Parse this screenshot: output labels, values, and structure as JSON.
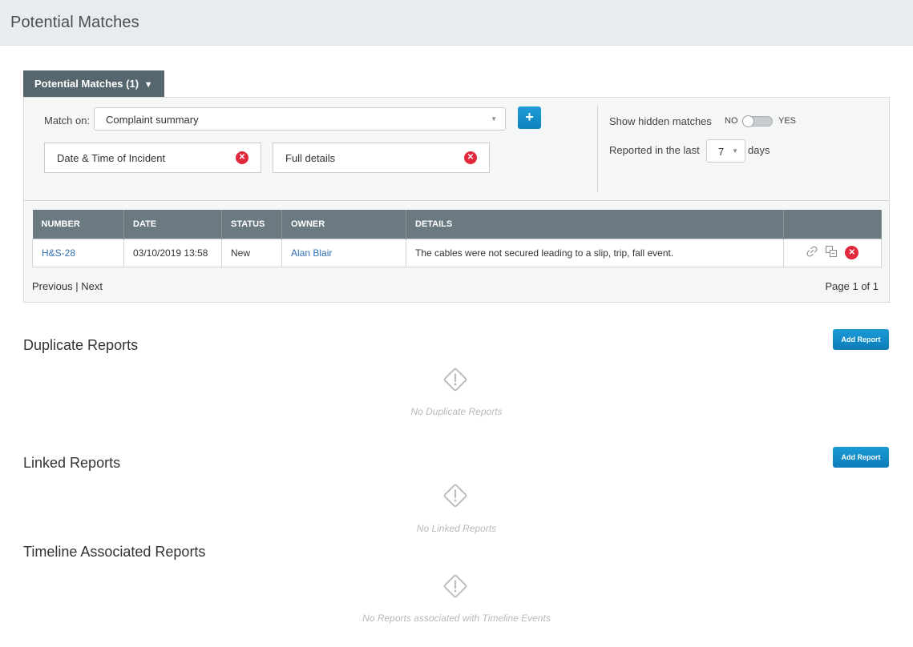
{
  "header": {
    "title": "Potential Matches"
  },
  "potential_matches": {
    "tab_label": "Potential Matches (1)",
    "tab_caret": "▼",
    "match_on_label": "Match on:",
    "match_on_value": "Complaint summary",
    "add_button_symbol": "+",
    "criteria": [
      {
        "label": "Date & Time of Incident"
      },
      {
        "label": "Full details"
      }
    ],
    "show_hidden_label": "Show hidden matches",
    "toggle_no": "NO",
    "toggle_yes": "YES",
    "reported_label": "Reported in the last",
    "days_value": "7",
    "days_label": "days",
    "table": {
      "columns": [
        "NUMBER",
        "DATE",
        "STATUS",
        "OWNER",
        "DETAILS",
        ""
      ],
      "rows": [
        {
          "number": "H&S-28",
          "date": "03/10/2019 13:58",
          "status": "New",
          "owner": "Alan Blair",
          "details": "The cables were not secured leading to a slip, trip, fall event."
        }
      ]
    },
    "pager": {
      "previous": "Previous",
      "separator": "|",
      "next": "Next",
      "page_text": "Page 1 of 1"
    }
  },
  "sections": [
    {
      "title": "Duplicate Reports",
      "button_label": "Add Report",
      "empty_text": "No Duplicate Reports"
    },
    {
      "title": "Linked Reports",
      "button_label": "Add Report",
      "empty_text": "No Linked Reports"
    },
    {
      "title": "Timeline Associated Reports",
      "empty_text": "No Reports associated with Timeline Events"
    }
  ],
  "icons": {
    "empty_state": "warning-diamond-icon",
    "row_link": "link-icon",
    "row_merge": "duplicate-icon",
    "remove": "close-circle-icon"
  },
  "colors": {
    "tab_bg": "#56666e",
    "table_header_bg": "#6a7a80",
    "primary_button": "#1a9bd6",
    "danger": "#e2283c",
    "link": "#2f6fb5"
  }
}
